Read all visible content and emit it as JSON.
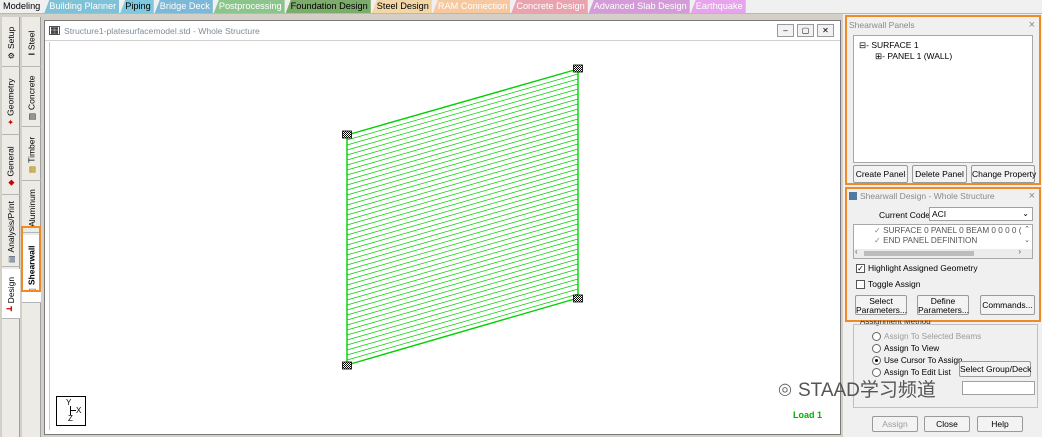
{
  "top_tabs": [
    {
      "label": "Modeling",
      "bg": "#f0f0f0",
      "fg": "#000000"
    },
    {
      "label": "Building Planner",
      "bg": "#7fc1d6",
      "fg": "#ffffff"
    },
    {
      "label": "Piping",
      "bg": "#7fc8e0",
      "fg": "#000000"
    },
    {
      "label": "Bridge Deck",
      "bg": "#7cb8d8",
      "fg": "#ffffff"
    },
    {
      "label": "Postprocessing",
      "bg": "#8cc58c",
      "fg": "#ffffff"
    },
    {
      "label": "Foundation Design",
      "bg": "#7cab6c",
      "fg": "#000000"
    },
    {
      "label": "Steel Design",
      "bg": "#f2d6a8",
      "fg": "#000000"
    },
    {
      "label": "RAM Connection",
      "bg": "#f6c8a0",
      "fg": "#ffffff"
    },
    {
      "label": "Concrete Design",
      "bg": "#e9a3ae",
      "fg": "#ffffff"
    },
    {
      "label": "Advanced Slab Design",
      "bg": "#d39bd8",
      "fg": "#ffffff"
    },
    {
      "label": "Earthquake",
      "bg": "#e7a3ec",
      "fg": "#ffffff"
    }
  ],
  "left_tabs_outer": [
    {
      "label": "Setup",
      "icon": "setup-icon"
    },
    {
      "label": "Geometry",
      "icon": "geometry-icon"
    },
    {
      "label": "General",
      "icon": "general-icon"
    },
    {
      "label": "Analysis/Print",
      "icon": "analysis-icon"
    },
    {
      "label": "Design",
      "icon": "design-icon"
    }
  ],
  "left_tabs_inner": [
    {
      "label": "Steel",
      "icon": "steel-icon"
    },
    {
      "label": "Concrete",
      "icon": "concrete-icon"
    },
    {
      "label": "Timber",
      "icon": "timber-icon"
    },
    {
      "label": "Aluminum",
      "icon": "aluminum-icon"
    },
    {
      "label": "Shearwall",
      "icon": "shearwall-icon"
    }
  ],
  "viewport": {
    "title": "Structure1-platesurfacemodel.std - Whole Structure",
    "btn_min": "–",
    "btn_max": "▢",
    "btn_close": "✕",
    "load_label": "Load 1",
    "axis_y": "Y",
    "axis_x": "X",
    "axis_z": "Z"
  },
  "panels_dialog": {
    "title": "Shearwall Panels",
    "tree": [
      "⊟- SURFACE 1",
      "⊞- PANEL 1 (WALL)"
    ],
    "buttons": [
      "Create Panel",
      "Delete Panel",
      "Change Property"
    ]
  },
  "design_dialog": {
    "title": "Shearwall Design - Whole Structure",
    "code_label": "Current Code:",
    "code_value": "ACI",
    "list_lines": [
      "SURFACE 0 PANEL 0 BEAM 0 0 0 0 (",
      "END PANEL DEFINITION"
    ],
    "highlight_label": "Highlight Assigned Geometry",
    "toggle_label": "Toggle Assign",
    "btn_select": [
      "Select",
      "Parameters..."
    ],
    "btn_define": [
      "Define",
      "Parameters..."
    ],
    "btn_commands": "Commands..."
  },
  "assignment": {
    "group_label": "Assignment Method",
    "options": [
      "Assign To Selected Beams",
      "Assign To View",
      "Use Cursor To Assign",
      "Assign To Edit List"
    ],
    "select_group_btn": "Select Group/Deck",
    "assign_btn": "Assign",
    "close_btn": "Close",
    "help_btn": "Help"
  },
  "watermark": "STAAD学习频道",
  "colors": {
    "highlight": "#f08a24",
    "mesh": "#00d000",
    "load": "#00b000"
  }
}
